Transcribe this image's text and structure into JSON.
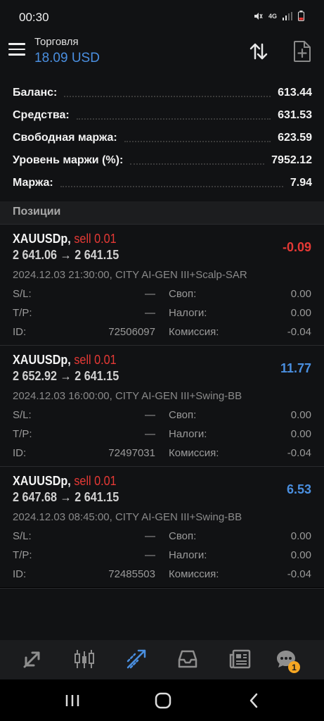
{
  "status_bar": {
    "time": "00:30",
    "network": "4G"
  },
  "header": {
    "title": "Торговля",
    "subtitle": "18.09 USD"
  },
  "summary": [
    {
      "label": "Баланс:",
      "value": "613.44"
    },
    {
      "label": "Средства:",
      "value": "631.53"
    },
    {
      "label": "Свободная маржа:",
      "value": "623.59"
    },
    {
      "label": "Уровень маржи (%):",
      "value": "7952.12"
    },
    {
      "label": "Маржа:",
      "value": "7.94"
    }
  ],
  "section_title": "Позиции",
  "field_labels": {
    "sl": "S/L:",
    "tp": "T/P:",
    "id": "ID:",
    "swap": "Своп:",
    "taxes": "Налоги:",
    "commission": "Комиссия:"
  },
  "positions": [
    {
      "symbol": "XAUUSDp,",
      "side": "sell 0.01",
      "prices": "2 641.06 → 2 641.15",
      "profit": "-0.09",
      "profit_color": "#e53935",
      "comment": "2024.12.03 21:30:00, CITY AI-GEN III+Scalp-SAR",
      "sl": "—",
      "tp": "—",
      "id": "72506097",
      "swap": "0.00",
      "taxes": "0.00",
      "commission": "-0.04"
    },
    {
      "symbol": "XAUUSDp,",
      "side": "sell 0.01",
      "prices": "2 652.92 → 2 641.15",
      "profit": "11.77",
      "profit_color": "#4a8fe0",
      "comment": "2024.12.03 16:00:00, CITY AI-GEN III+Swing-BB",
      "sl": "—",
      "tp": "—",
      "id": "72497031",
      "swap": "0.00",
      "taxes": "0.00",
      "commission": "-0.04"
    },
    {
      "symbol": "XAUUSDp,",
      "side": "sell 0.01",
      "prices": "2 647.68 → 2 641.15",
      "profit": "6.53",
      "profit_color": "#4a8fe0",
      "comment": "2024.12.03 08:45:00, CITY AI-GEN III+Swing-BB",
      "sl": "—",
      "tp": "—",
      "id": "72485503",
      "swap": "0.00",
      "taxes": "0.00",
      "commission": "-0.04"
    }
  ],
  "tabs": [
    {
      "icon": "quotes-icon",
      "active": false
    },
    {
      "icon": "chart-candles-icon",
      "active": false
    },
    {
      "icon": "trade-icon",
      "active": true
    },
    {
      "icon": "history-icon",
      "active": false
    },
    {
      "icon": "news-icon",
      "active": false
    },
    {
      "icon": "messages-icon",
      "active": false,
      "badge": "1"
    }
  ],
  "colors": {
    "accent": "#4a8fe0",
    "loss": "#e53935",
    "badge": "#f5a623"
  }
}
